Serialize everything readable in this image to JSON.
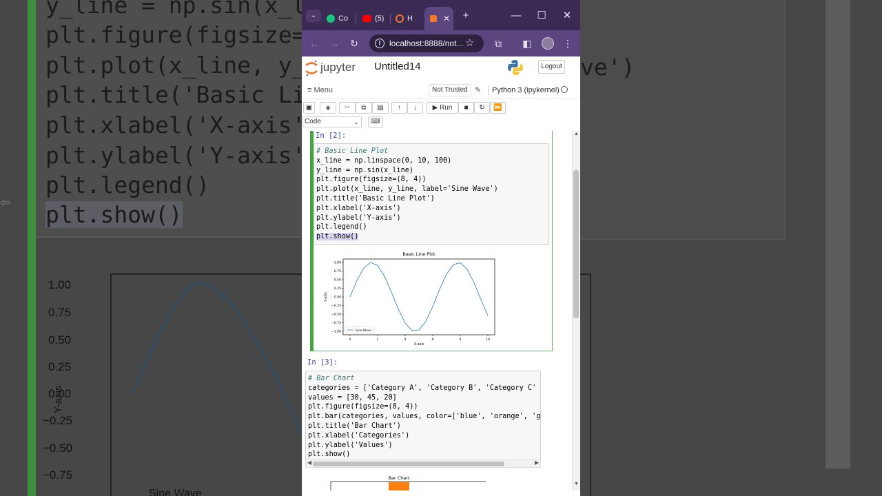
{
  "browser": {
    "tabs": [
      {
        "label": "Co",
        "icon": "chatgpt-icon"
      },
      {
        "label": "(5)",
        "icon": "youtube-icon"
      },
      {
        "label": "H",
        "icon": "jupyter-icon"
      },
      {
        "label": "",
        "icon": "notebook-icon"
      }
    ],
    "url": "localhost:8888/not...",
    "colors": {
      "frame": "#3b2a53",
      "toolbar": "#5b4680"
    }
  },
  "jupyter": {
    "brand": "jupyter",
    "notebook_title": "Untitled14",
    "logout_label": "Logout",
    "menu_label": "Menu",
    "trust_label": "Not Trusted",
    "kernel_label": "Python 3 (ipykernel)",
    "run_label": "Run",
    "cell_type": "Code"
  },
  "cells": [
    {
      "prompt": "In [2]:",
      "code_lines": [
        "# Basic Line Plot",
        "x_line = np.linspace(0, 10, 100)",
        "y_line = np.sin(x_line)",
        "plt.figure(figsize=(8, 4))",
        "plt.plot(x_line, y_line, label='Sine Wave')",
        "plt.title('Basic Line Plot')",
        "plt.xlabel('X-axis')",
        "plt.ylabel('Y-axis')",
        "plt.legend()",
        "plt.show()"
      ]
    },
    {
      "prompt": "In [3]:",
      "code_lines": [
        "# Bar Chart",
        "categories = ['Category A', 'Category B', 'Category C'",
        "values = [30, 45, 20]",
        "plt.figure(figsize=(8, 4))",
        "plt.bar(categories, values, color=['blue', 'orange', 'g",
        "plt.title('Bar Chart')",
        "plt.xlabel('Categories')",
        "plt.ylabel('Values')",
        "plt.show()"
      ]
    }
  ],
  "chart_data": [
    {
      "type": "line",
      "title": "Basic Line Plot",
      "xlabel": "X-axis",
      "ylabel": "Y-axis",
      "xlim": [
        -0.5,
        10.5
      ],
      "ylim": [
        -1.1,
        1.1
      ],
      "xticks": [
        "0",
        "2",
        "4",
        "6",
        "8",
        "10"
      ],
      "yticks": [
        "1.00",
        "0.75",
        "0.50",
        "0.25",
        "0.00",
        "−0.25",
        "−0.50",
        "−0.75",
        "−1.00"
      ],
      "legend": "lower-left",
      "series": [
        {
          "name": "Sine Wave",
          "color": "#1f77b4",
          "x": [
            0,
            0.5,
            1,
            1.5,
            2,
            2.5,
            3,
            3.5,
            4,
            4.5,
            5,
            5.5,
            6,
            6.5,
            7,
            7.5,
            8,
            8.5,
            9,
            9.5,
            10
          ],
          "y": [
            0,
            0.48,
            0.84,
            1.0,
            0.91,
            0.6,
            0.14,
            -0.35,
            -0.76,
            -0.98,
            -0.96,
            -0.71,
            -0.28,
            0.22,
            0.66,
            0.94,
            0.99,
            0.8,
            0.41,
            -0.08,
            -0.54
          ]
        }
      ]
    },
    {
      "type": "bar",
      "title": "Bar Chart"
    }
  ],
  "background_zoom": {
    "code_lines": [
      "y_line = np.sin(x_l",
      "plt.figure(figsize=",
      "plt.plot(x_line, y_",
      "plt.title('Basic Li",
      "plt.xlabel('X-axis'",
      "plt.ylabel('Y-axis'",
      "plt.legend()",
      "plt.show()"
    ],
    "right_text": "ve')",
    "yticks": [
      "1.00",
      "0.75",
      "0.50",
      "0.25",
      "0.00",
      "−0.25",
      "−0.50",
      "−0.75"
    ],
    "ylabel": "Y-axis",
    "legend_label": "Sine Wave"
  }
}
